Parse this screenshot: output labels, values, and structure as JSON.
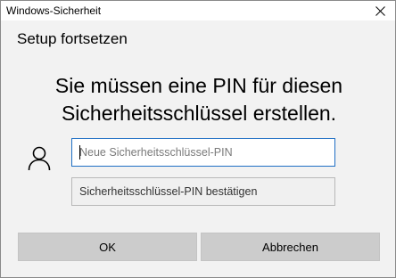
{
  "window": {
    "title": "Windows-Sicherheit",
    "close_icon": "close-icon"
  },
  "dialog": {
    "header": "Setup fortsetzen",
    "message_line1": "Sie müssen eine PIN für diesen",
    "message_line2": "Sicherheitsschlüssel erstellen.",
    "user_icon": "user-icon",
    "pin_field": {
      "placeholder": "Neue Sicherheitsschlüssel-PIN",
      "value": ""
    },
    "confirm_field": {
      "placeholder": "Sicherheitsschlüssel-PIN bestätigen",
      "value": ""
    },
    "ok_label": "OK",
    "cancel_label": "Abbrechen"
  },
  "colors": {
    "dialog_background": "#f2f2f2",
    "focused_border": "#1f6fc4",
    "button_background": "#cccccc"
  }
}
